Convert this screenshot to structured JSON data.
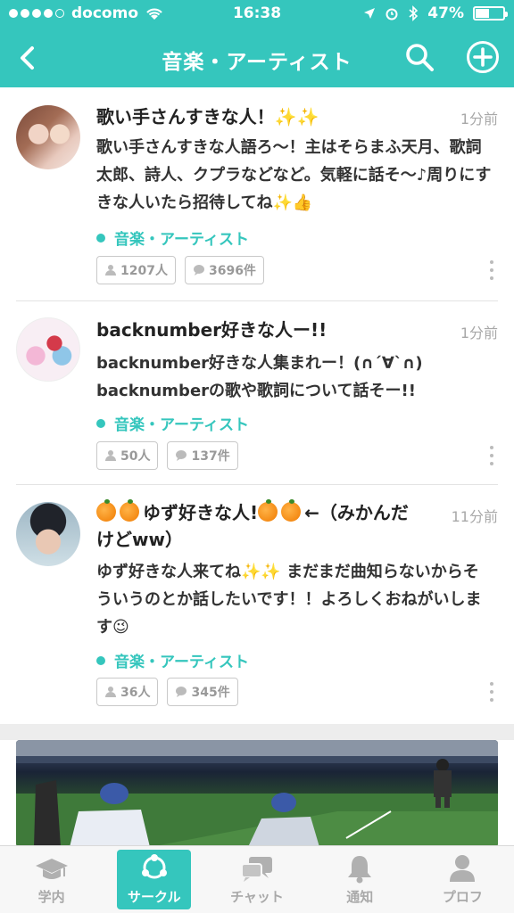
{
  "status_bar": {
    "carrier": "docomo",
    "time": "16:38",
    "battery": "47%",
    "battery_level": 0.47
  },
  "nav": {
    "title": "音楽・アーティスト",
    "back_icon": "chevron-left-icon",
    "search_icon": "search-icon",
    "add_icon": "plus-circle-icon"
  },
  "posts": [
    {
      "title": "歌い手さんすきな人！✨✨",
      "time": "1分前",
      "body": "歌い手さんすきな人語ろ〜！主はそらまふ天月、歌詞太郎、詩人、クプラなどなど。気軽に話そ〜♪周りにすきな人いたら招待してね✨👍",
      "category": "音楽・アーティスト",
      "members": "1207人",
      "comments": "3696件"
    },
    {
      "title": "backnumber好きな人ー!!",
      "time": "1分前",
      "body": "backnumber好きな人集まれー！(∩´∀`∩)\nbacknumberの歌や歌詞について話そー!!",
      "category": "音楽・アーティスト",
      "members": "50人",
      "comments": "137件"
    },
    {
      "title_prefix": "ゆず好きな人!",
      "title_suffix": "←（みかんだけどww）",
      "time": "11分前",
      "body": "ゆず好きな人来てね✨✨ まだまだ曲知らないからそういうのとか話したいです！！よろしくおねがいします😉",
      "category": "音楽・アーティスト",
      "members": "36人",
      "comments": "345件"
    }
  ],
  "tabs": [
    {
      "label": "学内",
      "icon": "graduation-cap-icon"
    },
    {
      "label": "サークル",
      "icon": "circle-network-icon"
    },
    {
      "label": "チャット",
      "icon": "chat-bubbles-icon"
    },
    {
      "label": "通知",
      "icon": "bell-icon"
    },
    {
      "label": "プロフ",
      "icon": "user-icon"
    }
  ],
  "colors": {
    "accent": "#35c6bd",
    "time_gray": "#a8a8a8"
  }
}
